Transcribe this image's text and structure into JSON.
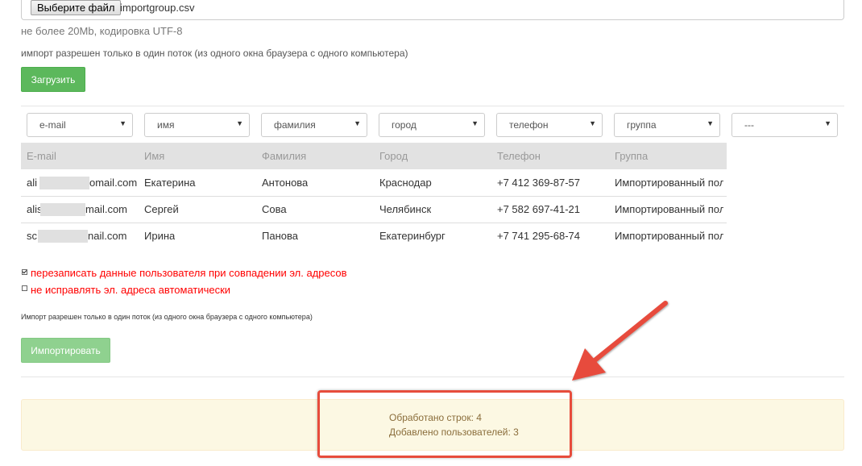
{
  "upload": {
    "button_label": "Выберите файл",
    "file_name": "importgroup.csv",
    "size_hint": "не более 20Mb, кодировка UTF-8",
    "thread_hint": "импорт разрешен только в один поток (из одного окна браузера с одного компьютера)",
    "load_button": "Загрузить"
  },
  "mapping": {
    "selects": [
      "e-mail",
      "имя",
      "фамилия",
      "город",
      "телефон",
      "группа",
      "---"
    ]
  },
  "table": {
    "headers": [
      "E-mail",
      "Имя",
      "Фамилия",
      "Город",
      "Телефон",
      "Группа"
    ],
    "rows": [
      [
        "ali",
        "omail.com",
        "Екатерина",
        "Антонова",
        "Краснодар",
        "+7 412 369-87-57",
        "Импортированный пол..."
      ],
      [
        "alis",
        "mail.com",
        "Сергей",
        "Сова",
        "Челябинск",
        "+7 582 697-41-21",
        "Импортированный пол..."
      ],
      [
        "sc",
        "nail.com",
        "Ирина",
        "Панова",
        "Екатеринбург",
        "+7 741 295-68-74",
        "Импортированный пол..."
      ]
    ]
  },
  "options": {
    "overwrite_label": "перезаписать данные пользователя при совпадении эл. адресов",
    "overwrite_checked": true,
    "no_fix_label": "не исправлять эл. адреса автоматически",
    "no_fix_checked": false
  },
  "import": {
    "note": "Импорт разрешен только в один поток (из одного окна браузера с одного компьютера)",
    "button_label": "Импортировать"
  },
  "result": {
    "processed": "Обработано строк: 4",
    "added": "Добавлено пользователей: 3"
  },
  "colors": {
    "accent_green": "#5cb85c",
    "annotation_red": "#e74c3c",
    "alert_bg": "#fcf8e3",
    "alert_text": "#8a6d3b",
    "option_red": "#ff0000"
  }
}
